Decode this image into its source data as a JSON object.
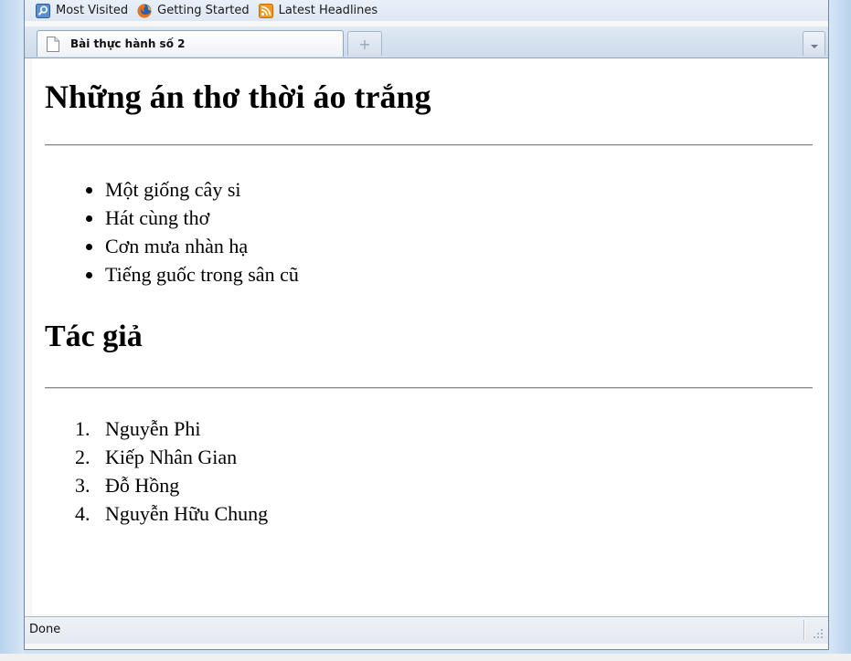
{
  "bookmarks_toolbar": {
    "items": [
      {
        "label": "Most Visited",
        "icon": "magnifier-icon"
      },
      {
        "label": "Getting Started",
        "icon": "firefox-icon"
      },
      {
        "label": "Latest Headlines",
        "icon": "rss-feed-icon"
      }
    ]
  },
  "tabs": [
    {
      "label": "Bài thực hành số 2",
      "active": true
    }
  ],
  "new_tab_glyph": "+",
  "page": {
    "heading": "Những án thơ thời áo trắng",
    "poems": [
      "Một giống cây si",
      "Hát cùng thơ",
      "Cơn mưa nhàn hạ",
      "Tiếng guốc trong sân cũ"
    ],
    "authors_heading": "Tác giả",
    "authors": [
      {
        "number": "1.",
        "name": "Nguyễn Phi"
      },
      {
        "number": "2.",
        "name": "Kiếp Nhân Gian"
      },
      {
        "number": "3.",
        "name": "Đỗ Hồng"
      },
      {
        "number": "4.",
        "name": "Nguyễn Hữu Chung"
      }
    ]
  },
  "status_bar": {
    "text": "Done"
  },
  "colors": {
    "frame": "#cfe2f4",
    "window_border": "#6e89a6",
    "content_bg": "#ffffff",
    "text": "#000000"
  }
}
